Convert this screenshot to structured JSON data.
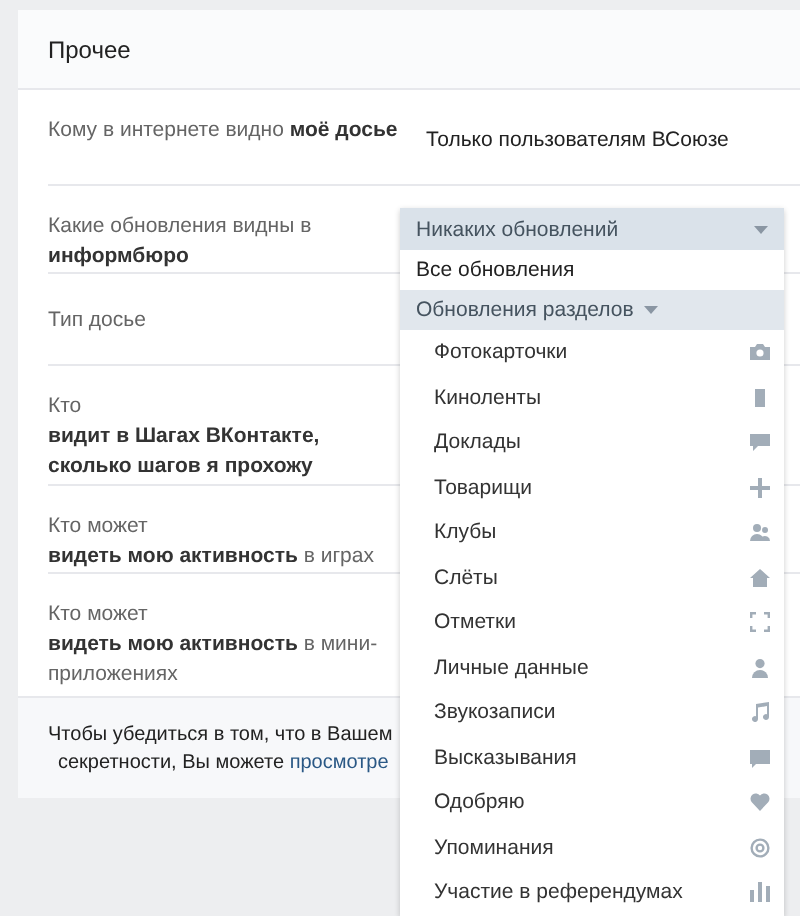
{
  "section": {
    "title": "Прочее"
  },
  "rows": [
    {
      "label": "Кому в интернете видно **моё досье**",
      "value": "Только пользователям ВСоюзе"
    },
    {
      "label": "Какие обновления видны в **информбюро**"
    },
    {
      "label": "Тип досье"
    },
    {
      "label": "Кто\n**видит в Шагах ВКонтакте, сколько шагов я прохожу**"
    },
    {
      "label": "Кто может\n**видеть мою активность** в играх"
    },
    {
      "label": "Кто может\n**видеть мою активность** в мини-приложениях"
    }
  ],
  "footer": {
    "lines": [
      "Чтобы убедиться в том, что в Вашем",
      "секретности, Вы можете "
    ],
    "link": "просмотре"
  },
  "dropdown": {
    "value": "Никаких обновлений",
    "options": [
      {
        "kind": "option",
        "label": "Все обновления"
      },
      {
        "kind": "group",
        "label": "Обновления разделов",
        "expanded": true,
        "children": [
          {
            "label": "Фотокарточки"
          },
          {
            "label": "Киноленты"
          },
          {
            "label": "Доклады"
          },
          {
            "label": "Товарищи"
          },
          {
            "label": "Клубы"
          },
          {
            "label": "Слёты"
          },
          {
            "label": "Отметки"
          },
          {
            "label": "Личные данные"
          },
          {
            "label": "Звукозаписи"
          },
          {
            "label": "Высказывания"
          },
          {
            "label": "Одобряю"
          },
          {
            "label": "Упоминания"
          },
          {
            "label": "Участие в референдумах"
          }
        ]
      }
    ]
  }
}
